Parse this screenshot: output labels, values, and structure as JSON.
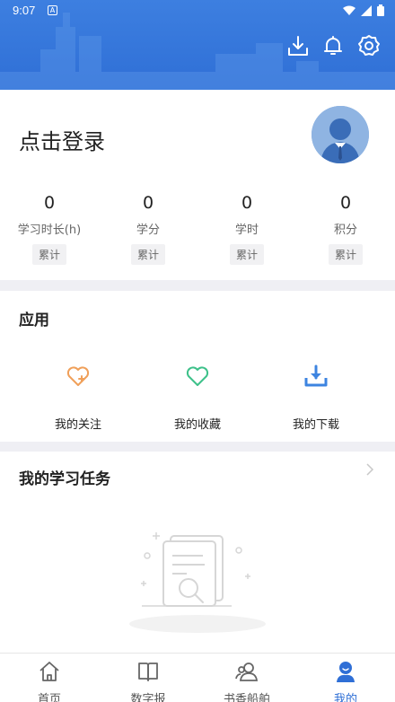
{
  "status_bar": {
    "time": "9:07",
    "notification_letter": "A"
  },
  "header": {
    "icons": [
      "download-icon",
      "bell-icon",
      "settings-icon"
    ]
  },
  "profile": {
    "login_text": "点击登录",
    "stats": [
      {
        "value": "0",
        "label": "学习时长(h)",
        "tag": "累计"
      },
      {
        "value": "0",
        "label": "学分",
        "tag": "累计"
      },
      {
        "value": "0",
        "label": "学时",
        "tag": "累计"
      },
      {
        "value": "0",
        "label": "积分",
        "tag": "累计"
      }
    ]
  },
  "apps": {
    "title": "应用",
    "items": [
      {
        "label": "我的关注",
        "icon": "heart-plus-icon",
        "color": "#f0a05a"
      },
      {
        "label": "我的收藏",
        "icon": "heart-icon",
        "color": "#3ec18a"
      },
      {
        "label": "我的下载",
        "icon": "download-tray-icon",
        "color": "#3d84e0"
      }
    ]
  },
  "tasks": {
    "title": "我的学习任务"
  },
  "nav": {
    "items": [
      {
        "label": "首页",
        "icon": "home-icon"
      },
      {
        "label": "数字报",
        "icon": "newspaper-icon"
      },
      {
        "label": "书香船舶",
        "icon": "group-icon"
      },
      {
        "label": "我的",
        "icon": "user-icon",
        "active": true
      }
    ]
  },
  "colors": {
    "primary": "#2f6fd6",
    "background": "#efeff4"
  }
}
